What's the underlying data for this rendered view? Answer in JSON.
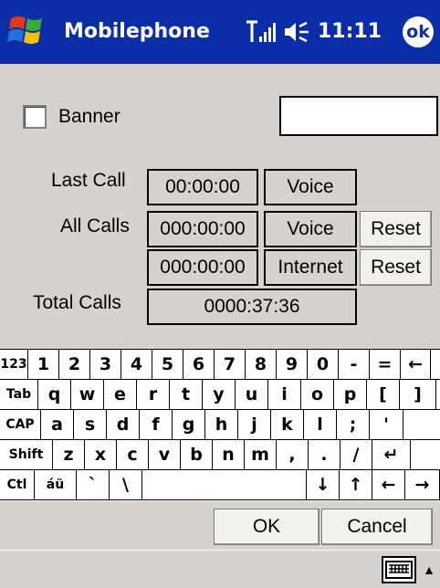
{
  "titlebar": {
    "title": "Mobilephone",
    "time": "11:11",
    "ok_label": "ok"
  },
  "form": {
    "banner_label": "Banner",
    "banner_value": "",
    "last_call_label": "Last Call",
    "last_call_time": "00:00:00",
    "last_call_type": "Voice",
    "all_calls_label": "All Calls",
    "all_calls_voice_time": "000:00:00",
    "all_calls_voice_type": "Voice",
    "all_calls_internet_time": "000:00:00",
    "all_calls_internet_type": "Internet",
    "reset_label": "Reset",
    "total_calls_label": "Total Calls",
    "total_calls_value": "0000:37:36"
  },
  "keyboard": {
    "rows": [
      [
        "123",
        "1",
        "2",
        "3",
        "4",
        "5",
        "6",
        "7",
        "8",
        "9",
        "0",
        "-",
        "=",
        "←"
      ],
      [
        "Tab",
        "q",
        "w",
        "e",
        "r",
        "t",
        "y",
        "u",
        "i",
        "o",
        "p",
        "[",
        "]"
      ],
      [
        "CAP",
        "a",
        "s",
        "d",
        "f",
        "g",
        "h",
        "j",
        "k",
        "l",
        ";",
        "'"
      ],
      [
        "Shift",
        "z",
        "x",
        "c",
        "v",
        "b",
        "n",
        "m",
        ",",
        ".",
        "/",
        "↵"
      ],
      [
        "Ctl",
        "áü",
        "`",
        "\\",
        "",
        "↓",
        "↑",
        "←",
        "→"
      ]
    ]
  },
  "buttons": {
    "ok": "OK",
    "cancel": "Cancel"
  },
  "icons": {
    "start": "windows-flag-icon",
    "signal": "signal-icon",
    "volume": "volume-icon",
    "sip": "keyboard-icon",
    "sip_arrow": "chevron-up-icon"
  },
  "colors": {
    "titlebar": "#0a2ea8",
    "background": "#d6d3ce"
  }
}
